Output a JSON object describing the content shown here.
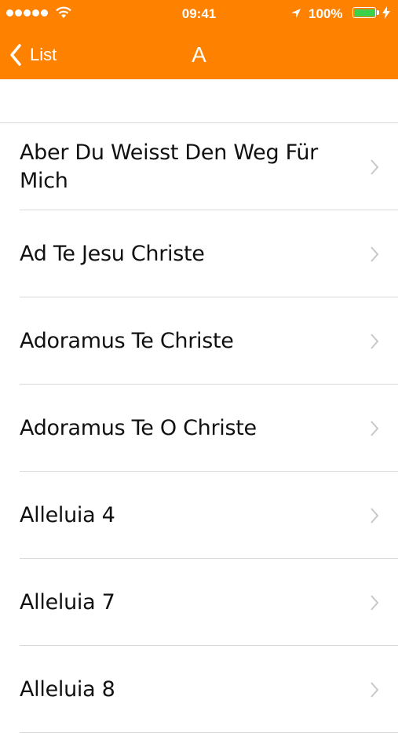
{
  "status_bar": {
    "time": "09:41",
    "battery": "100%",
    "battery_level": 1.0
  },
  "nav": {
    "back_label": "List",
    "title": "A"
  },
  "items": [
    {
      "label": "Aber Du Weisst Den Weg Für Mich"
    },
    {
      "label": "Ad Te Jesu Christe"
    },
    {
      "label": "Adoramus Te Christe"
    },
    {
      "label": "Adoramus Te O Christe"
    },
    {
      "label": "Alleluia 4"
    },
    {
      "label": "Alleluia 7"
    },
    {
      "label": "Alleluia 8"
    }
  ],
  "colors": {
    "nav_background": "#fe8100",
    "separator": "#d9d9d9",
    "chevron": "#c7c7cc"
  },
  "icons": [
    "signal-dots-icon",
    "wifi-icon",
    "location-arrow-icon",
    "battery-icon",
    "charging-bolt-icon",
    "back-chevron-icon",
    "disclosure-chevron-icon"
  ]
}
